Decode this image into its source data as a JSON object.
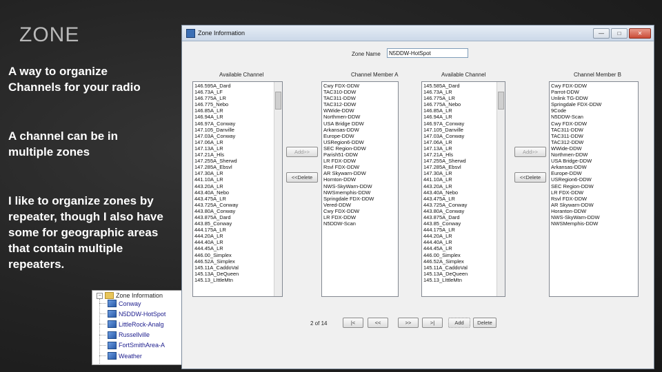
{
  "slide": {
    "title": "ZONE",
    "bullets": [
      "A way to organize Channels for your radio",
      "A channel can be in multiple zones",
      "I like to organize zones by repeater, though   I also have some for geographic areas that contain multiple repeaters."
    ]
  },
  "tree": {
    "root_label": "Zone Information",
    "expander": "−",
    "items": [
      "Conway",
      "N5DDW-HotSpot",
      "LittleRock-Analg",
      "Russellville",
      "FortSmithArea-A",
      "Weather"
    ]
  },
  "window": {
    "title": "Zone Information",
    "minimize": "—",
    "maximize": "□",
    "close": "✕",
    "zone_name_label": "Zone Name",
    "zone_name_value": "N5DDW-HotSpot",
    "headers": {
      "available_a": "Available Channel",
      "member_a": "Channel Member A",
      "available_b": "Available Channel",
      "member_b": "Channel Member B"
    },
    "available_channels_a": [
      "146.595A_Dard",
      "146.73A_LF",
      "146.775A_LR",
      "146.775_Nebo",
      "146.85A_LR",
      "146.94A_LR",
      "146.97A_Conway",
      "147.105_Danville",
      "147.03A_Conway",
      "147.06A_LR",
      "147.13A_LR",
      "147.21A_Hls",
      "147.255A_Sherwd",
      "147.285A_Ebsvl",
      "147.30A_LR",
      "441.10A_LR",
      "443.20A_LR",
      "443.40A_Nebo",
      "443.475A_LR",
      "443.725A_Conway",
      "443.80A_Conway",
      "443.875A_Dard",
      "443.85_Conway",
      "444.175A_LR",
      "444.20A_LR",
      "444.40A_LR",
      "444.45A_LR",
      "446.00_Simplex",
      "446.52A_Simplex",
      "145.11A_CaddoVal",
      "145.13A_DeQueen",
      "145.13_LIttleMtn"
    ],
    "channel_members_a": [
      "Cwy FDX-DDW",
      "TAC310-DDW",
      "TAC311-DDW",
      "TAC312-DDW",
      "WWide-DDW",
      "Northmen-DDW",
      "USA Bridge DDW",
      "Arkansas-DDW",
      "Europe-DDW",
      "USRegion6-DDW",
      "SEC Region-DDW",
      "Parish51-DDW",
      "LR FDX-DDW",
      "Rsvl FDX-DDW",
      "AR Skywarn-DDW",
      "Hornton-DDW",
      "NWS-SkyWarn-DDW",
      "NWSmemphis-DDW",
      "Springdale FDX-DDW",
      "Vered-DDW",
      "Cwy FDX-DDW",
      "LR FDX-DDW",
      "N5DDW-Scan"
    ],
    "available_channels_b": [
      "145.585A_Dard",
      "146.73A_LR",
      "146.775A_LR",
      "146.775A_Nebo",
      "146.85A_LR",
      "146.94A_LR",
      "146.97A_Conway",
      "147.105_Danville",
      "147.03A_Conway",
      "147.06A_LR",
      "147.13A_LR",
      "147.21A_Hls",
      "147.255A_Sherwd",
      "147.285A_Ebsvl",
      "147.30A_LR",
      "441.10A_LR",
      "443.20A_LR",
      "443.40A_Nebo",
      "443.475A_LR",
      "443.725A_Conway",
      "443.80A_Conway",
      "443.875A_Dard",
      "443.85_Conway",
      "444.175A_LR",
      "444.20A_LR",
      "444.40A_LR",
      "444.45A_LR",
      "446.00_Simplex",
      "446.52A_Simplex",
      "145.11A_CaddoVal",
      "145.13A_DeQueen",
      "145.13_LIttleMtn"
    ],
    "channel_members_b": [
      "Cwy FDX-DDW",
      "Parrot-DDW",
      "Unlink TG-DDW",
      "Springdale FDX-DDW",
      "9Code",
      "N5DDW-Scan",
      "Cwy FDX-DDW",
      "TAC311-DDW",
      "TAC311-DDW",
      "TAC312-DDW",
      "WWide-DDW",
      "Northmen-DDW",
      "USA Bridge-DDW",
      "Arkansas-DDW",
      "Europe-DDW",
      "USRegion6-DDW",
      "SEC Region-DDW",
      "LR FDX-DDW",
      "Rsvl FDX-DDW",
      "AR Skywarn-DDW",
      "Horanton-DDW",
      "NWS-SkyWarn-DDW",
      "NWSMemphis-DDW"
    ],
    "buttons": {
      "add_a": "Add>>",
      "delete_a": "<<Delete",
      "add_b": "Add>>",
      "delete_b": "<<Delete"
    },
    "nav": {
      "page_indicator": "2 of 14",
      "first": "|<",
      "prev": "<<",
      "next": ">>",
      "last": ">|",
      "add": "Add",
      "delete": "Delete"
    }
  }
}
